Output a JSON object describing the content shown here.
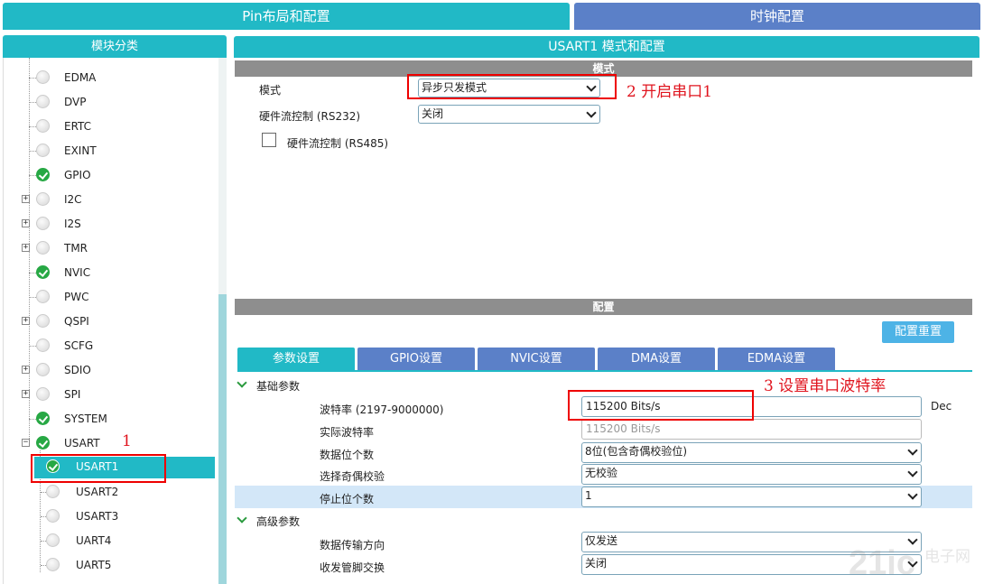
{
  "top_tabs": {
    "pin": "Pin布局和配置",
    "clock": "时钟配置"
  },
  "left": {
    "header": "模块分类",
    "items": [
      {
        "label": "EDMA",
        "status": "off",
        "expandable": false
      },
      {
        "label": "DVP",
        "status": "off",
        "expandable": false
      },
      {
        "label": "ERTC",
        "status": "off",
        "expandable": false
      },
      {
        "label": "EXINT",
        "status": "off",
        "expandable": false
      },
      {
        "label": "GPIO",
        "status": "ok",
        "expandable": false
      },
      {
        "label": "I2C",
        "status": "off",
        "expandable": true
      },
      {
        "label": "I2S",
        "status": "off",
        "expandable": true
      },
      {
        "label": "TMR",
        "status": "off",
        "expandable": true
      },
      {
        "label": "NVIC",
        "status": "ok",
        "expandable": false
      },
      {
        "label": "PWC",
        "status": "off",
        "expandable": false
      },
      {
        "label": "QSPI",
        "status": "off",
        "expandable": true
      },
      {
        "label": "SCFG",
        "status": "off",
        "expandable": false
      },
      {
        "label": "SDIO",
        "status": "off",
        "expandable": true
      },
      {
        "label": "SPI",
        "status": "off",
        "expandable": true
      },
      {
        "label": "SYSTEM",
        "status": "ok",
        "expandable": false
      },
      {
        "label": "USART",
        "status": "ok",
        "expandable": true,
        "expanded": true
      }
    ],
    "usart_children": [
      {
        "label": "USART1",
        "status": "ok",
        "selected": true
      },
      {
        "label": "USART2",
        "status": "off"
      },
      {
        "label": "USART3",
        "status": "off"
      },
      {
        "label": "UART4",
        "status": "off"
      },
      {
        "label": "UART5",
        "status": "off"
      }
    ],
    "expander_plus": "+",
    "expander_minus": "−"
  },
  "right": {
    "header": "USART1 模式和配置",
    "mode_section": "模式",
    "mode_label": "模式",
    "mode_value": "异步只发模式",
    "flow_label": "硬件流控制 (RS232)",
    "flow_value": "关闭",
    "rs485_label": "硬件流控制 (RS485)",
    "config_section": "配置",
    "reset_button": "配置重置",
    "tabs": [
      "参数设置",
      "GPIO设置",
      "NVIC设置",
      "DMA设置",
      "EDMA设置"
    ],
    "basic_group": "基础参数",
    "advanced_group": "高级参数",
    "params": {
      "baud_label": "波特率 (2197-9000000)",
      "baud_value": "115200 Bits/s",
      "baud_unit": "Dec",
      "actual_label": "实际波特率",
      "actual_value": "115200 Bits/s",
      "databits_label": "数据位个数",
      "databits_value": "8位(包含奇偶校验位)",
      "parity_label": "选择奇偶校验",
      "parity_value": "无校验",
      "stopbits_label": "停止位个数",
      "stopbits_value": "1",
      "direction_label": "数据传输方向",
      "direction_value": "仅发送",
      "swap_label": "收发管脚交换",
      "swap_value": "关闭"
    }
  },
  "annotations": {
    "a1": "1",
    "a2": "2  开启串口1",
    "a3": "3  设置串口波特率"
  },
  "watermark": "电子网",
  "colors": {
    "teal": "#21b9c6",
    "blue": "#5b80c8",
    "ok_green": "#27a844",
    "annot_red": "#e0141e"
  }
}
